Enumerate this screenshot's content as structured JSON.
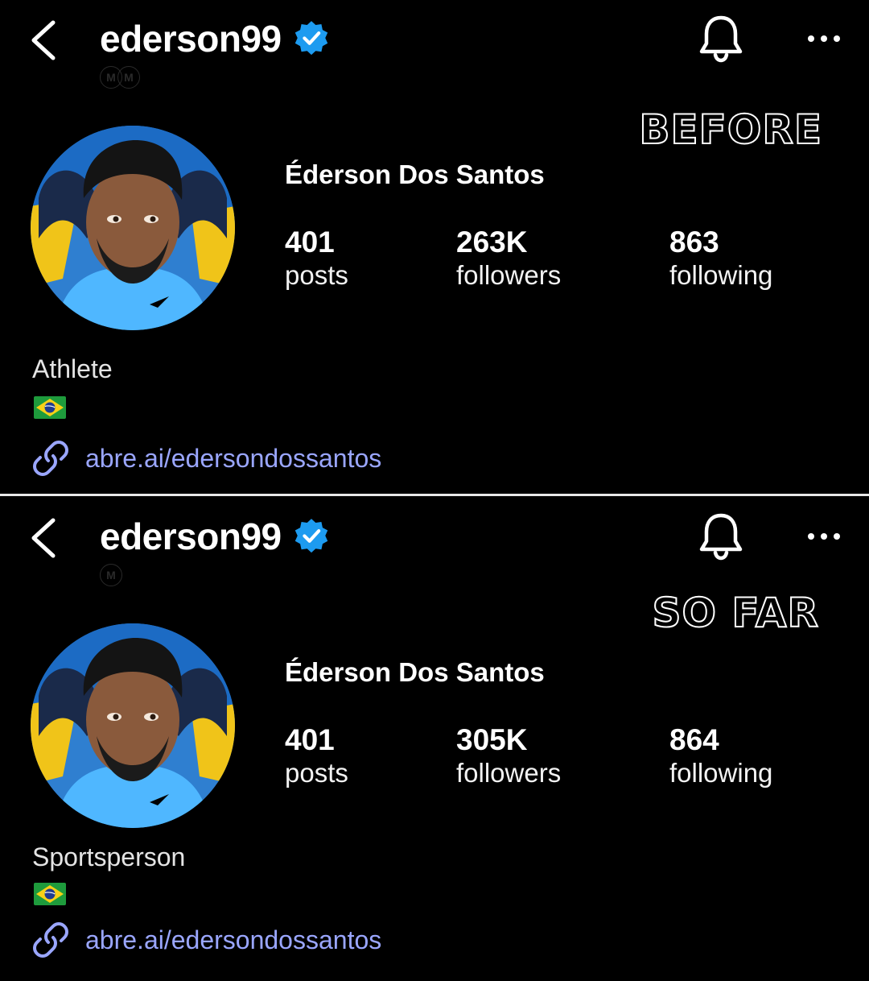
{
  "panels": [
    {
      "overlay_label": "BEFORE",
      "username": "ederson99",
      "full_name": "Éderson Dos Santos",
      "stats": {
        "posts": {
          "value": "401",
          "label": "posts"
        },
        "followers": {
          "value": "263K",
          "label": "followers"
        },
        "following": {
          "value": "863",
          "label": "following"
        }
      },
      "category": "Athlete",
      "link": "abre.ai/edersondossantos"
    },
    {
      "overlay_label": "SO FAR",
      "username": "ederson99",
      "full_name": "Éderson Dos Santos",
      "stats": {
        "posts": {
          "value": "401",
          "label": "posts"
        },
        "followers": {
          "value": "305K",
          "label": "followers"
        },
        "following": {
          "value": "864",
          "label": "following"
        }
      },
      "category": "Sportsperson",
      "link": "abre.ai/edersondossantos"
    }
  ],
  "icons": {
    "back": "chevron-left-icon",
    "verified": "verified-badge-icon",
    "notifications": "bell-icon",
    "more": "more-horizontal-icon",
    "link": "link-icon",
    "flag": "brazil-flag-icon",
    "threads": "threads-badge-icon"
  },
  "colors": {
    "background": "#000000",
    "verified": "#1d9bf0",
    "link": "#9aa6ff",
    "divider": "#e8e8e8"
  }
}
